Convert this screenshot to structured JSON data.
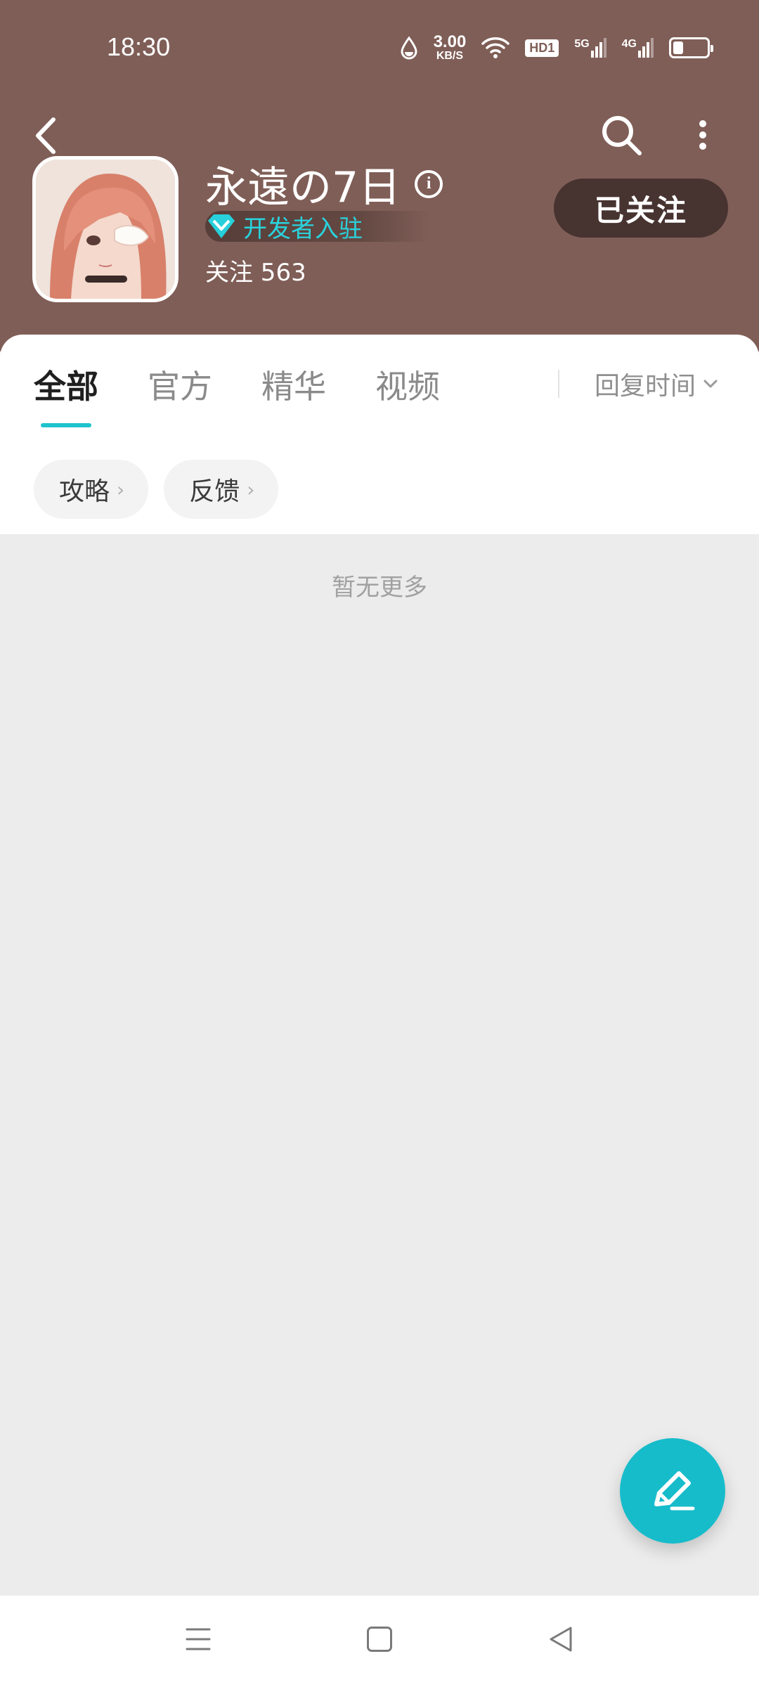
{
  "status_bar": {
    "time": "18:30",
    "speed_value": "3.00",
    "speed_unit": "KB/S",
    "hd_label": "HD1",
    "net1": "5G",
    "net2": "4G",
    "battery_level": 0.25
  },
  "header": {
    "game_title": "永遠の7日",
    "badge_label": "开发者入驻",
    "follow_count": "关注 563",
    "follow_button": "已关注"
  },
  "tabs": [
    {
      "label": "全部",
      "active": true
    },
    {
      "label": "官方",
      "active": false
    },
    {
      "label": "精华",
      "active": false
    },
    {
      "label": "视频",
      "active": false
    }
  ],
  "sort": {
    "label": "回复时间"
  },
  "chips": [
    {
      "label": "攻略"
    },
    {
      "label": "反馈"
    }
  ],
  "empty_state": {
    "text": "暂无更多"
  },
  "colors": {
    "header_bg": "#7f5e57",
    "accent": "#1ec3cc",
    "follow_btn_bg": "#473330",
    "fab_bg": "#17bccb"
  }
}
